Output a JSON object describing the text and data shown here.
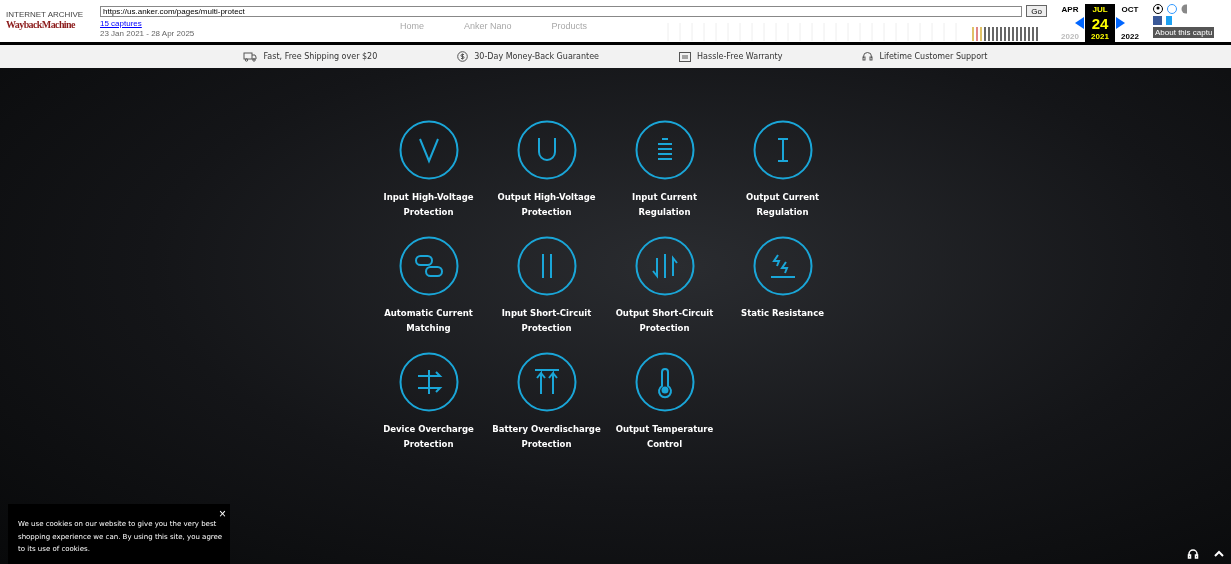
{
  "wayback": {
    "logo_top": "INTERNET ARCHIVE",
    "logo": "WaybackMachine",
    "url": "https://us.anker.com/pages/multi-protect",
    "captures": "15 captures",
    "range": "23 Jan 2021 - 28 Apr 2025",
    "go": "Go",
    "months": [
      {
        "label": "APR",
        "selected": false
      },
      {
        "label": "JUL",
        "selected": true
      },
      {
        "label": "OCT",
        "selected": false
      }
    ],
    "day": "24",
    "years": [
      {
        "label": "2020",
        "selected": false
      },
      {
        "label": "2021",
        "selected": true
      },
      {
        "label": "2022",
        "selected": false
      }
    ],
    "about": "About this captu"
  },
  "nav": [
    "Home",
    "Anker Nano",
    "Products"
  ],
  "perks": [
    "Fast, Free Shipping over $20",
    "30-Day Money-Back Guarantee",
    "Hassle-Free Warranty",
    "Lifetime Customer Support"
  ],
  "features": [
    {
      "line1": "Input High-Voltage",
      "line2": "Protection"
    },
    {
      "line1": "Output High-Voltage",
      "line2": "Protection"
    },
    {
      "line1": "Input Current",
      "line2": "Regulation"
    },
    {
      "line1": "Output Current",
      "line2": "Regulation"
    },
    {
      "line1": "Automatic Current",
      "line2": "Matching"
    },
    {
      "line1": "Input Short-Circuit",
      "line2": "Protection"
    },
    {
      "line1": "Output Short-Circuit",
      "line2": "Protection"
    },
    {
      "line1": "Static Resistance"
    },
    {
      "line1": "Device Overcharge",
      "line2": "Protection"
    },
    {
      "line1": "Battery Overdischarge",
      "line2": "Protection"
    },
    {
      "line1": "Output Temperature",
      "line2": "Control"
    }
  ],
  "cookie": {
    "text": "We use cookies on our website to give you the very best shopping experience we can. By using this site, you agree to its use of cookies.",
    "close": "×"
  }
}
